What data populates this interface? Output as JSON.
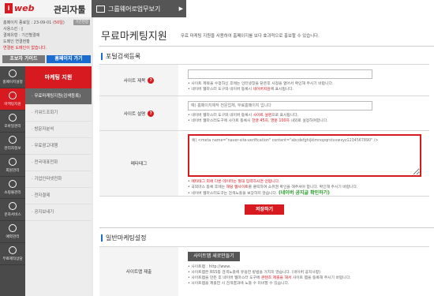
{
  "header": {
    "logo_mark": "i",
    "logo_text": "web",
    "admin_title": "관리자툴",
    "group_button": "그룹웨어로업무보기",
    "group_arrow": "▶"
  },
  "account": {
    "line1": "홈페이지 종료일 : 23-09-01 (",
    "line1_red": "50일",
    "line1_end": ")",
    "badge": "기간연장",
    "line2": "사용스킨 :",
    "line3": "결제유형 : 기간별결제",
    "line4": "도메인 연결현황",
    "line5": "연결된 도메인이 없습니다."
  },
  "top_buttons": {
    "guide": "초보자 가이드",
    "homepage": "홈페이지 가기"
  },
  "left_nav": [
    {
      "label": "홈페이지설정",
      "icon": "home-settings-icon",
      "active": false
    },
    {
      "label": "마케팅지원",
      "icon": "marketing-icon",
      "active": true
    },
    {
      "label": "모바일관리",
      "icon": "mobile-icon",
      "active": false
    },
    {
      "label": "관리자정보",
      "icon": "admin-info-icon",
      "active": false
    },
    {
      "label": "회원관리",
      "icon": "member-icon",
      "active": false
    },
    {
      "label": "쇼핑몰관리",
      "icon": "shop-icon",
      "active": false
    },
    {
      "label": "문자서비스",
      "icon": "sms-icon",
      "active": false
    },
    {
      "label": "예약관리",
      "icon": "reservation-icon",
      "active": false
    },
    {
      "label": "무료제작상담",
      "icon": "consult-icon",
      "active": false
    }
  ],
  "sub_nav": {
    "title": "마케팅 지원",
    "items": [
      {
        "label": "무료마케팅지원(검색등록)",
        "active": true
      },
      {
        "label": "키워드조회기",
        "active": false
      },
      {
        "label": "방문자분석",
        "active": false
      },
      {
        "label": "무료광고대행",
        "active": false
      },
      {
        "label": "전국대표전화",
        "active": false
      },
      {
        "label": "기업인터넷전화",
        "active": false
      },
      {
        "label": "전자결제",
        "active": false
      },
      {
        "label": "공지보내기",
        "active": false
      }
    ]
  },
  "page": {
    "title": "무료마케팅지원",
    "description": "무료 마케팅 지원을 사용하여 홈페이지를 보다 효과적으로 홍보할 수 있습니다."
  },
  "portal": {
    "section_title": "포털검색등록",
    "site_title": {
      "label": "사이트 제목",
      "q": "?",
      "value": "",
      "notes": [
        {
          "a": "사이트 제목을 수정하신 후에는 인터넷창을 닫은후 사정을 열어서 확인해 주시기 바랍니다."
        },
        {
          "a": "네이버 웹마스터 도구와 네이버 등록시 ",
          "r": "네이버지원",
          "b": "에 표시됩니다."
        }
      ]
    },
    "site_desc": {
      "label": "사이트 설명",
      "q": "?",
      "placeholder": "예) 홈페이지제작 전문업체, 무료홈페이지 입니다",
      "notes": [
        {
          "a": "네이버 웹마스터 도구와 네이버 등록시 ",
          "r": "사이트 설명",
          "b": "으로 표시됩니다."
        },
        {
          "a": "네이버 웹마스터도구에 사이트 등록시 ",
          "r": "한글 45자, 영문 100자",
          "b": " 내외로 설정하여합니다."
        }
      ]
    },
    "meta": {
      "label": "메타태그",
      "placeholder": "예) <meta name=\"naver-site-verification\" content=\"abcdefghijklmnopqrstuvwxyz1234567890\" />",
      "notes": [
        {
          "a": "",
          "r": "메타태그 외에 다른 데이터는 절대 입력하시면 안됩니다.",
          "b": ""
        },
        {
          "a": "국외마스 등록 후에는 ",
          "r": "해당 웹사이트",
          "b": "를 클릭하여 소유권 확인을 해주셔야 합니다. 확인해 주시기 바랍니다."
        },
        {
          "a": "네이버 웹마스터도구는 ",
          "r": "",
          "b": "검색노출을 보장하지 않습니다. ",
          "g": "(네이버 공지글 확인하기)"
        }
      ]
    },
    "save_button": "저장하기"
  },
  "general": {
    "section_title": "일반마케팅설정",
    "sitemap": {
      "label": "사이트맵 제출",
      "button": "사이트맵 새로만들기",
      "notes": [
        {
          "a": "사이트맵 : http://www.",
          "b": ""
        },
        {
          "a": "사이트맵은 RSS등 검색노출에 유용한 방법을 거치지 않습니다. (네이버 공지사항)",
          "b": ""
        },
        {
          "a": "사이트맵을 만든 후 네이버 웹마스터 도구에 ",
          "r": "콘텐츠 제출을 해서",
          "b": " 사이트 맵을 등록해 주시기 바랍니다."
        },
        {
          "a": "사이트맵을 제출한 시 검색결과에 노출 수 미비할 수 있습니다.",
          "b": ""
        }
      ]
    }
  },
  "colors": {
    "brand_red": "#d71920",
    "accent_blue": "#1a6cd1",
    "nav_dark": "#4a4a4a"
  }
}
